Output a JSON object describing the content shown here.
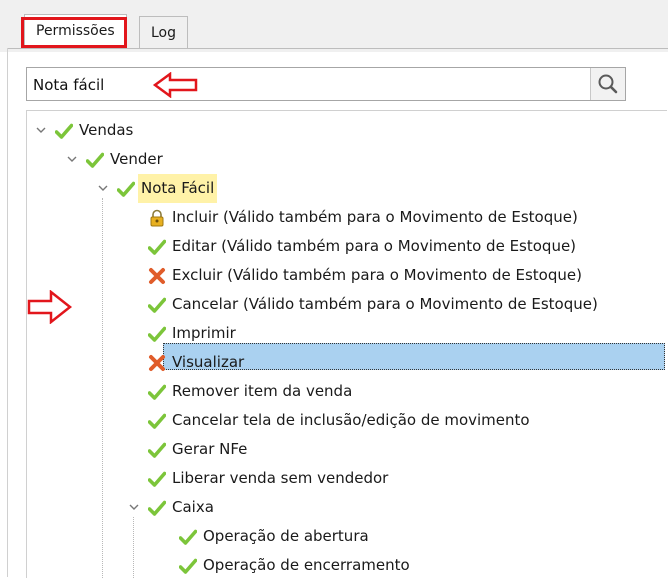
{
  "tabs": [
    {
      "label": "Permissões",
      "active": true
    },
    {
      "label": "Log",
      "active": false
    }
  ],
  "search": {
    "value": "Nota fácil",
    "button_icon": "search-icon"
  },
  "tree": [
    {
      "label": "Vendas",
      "icon": "check-icon",
      "expanded": true
    },
    {
      "label": "Vender",
      "icon": "check-icon",
      "expanded": true
    },
    {
      "label": "Nota Fácil",
      "icon": "check-icon",
      "expanded": true,
      "highlight": true
    },
    {
      "label": "Incluir (Válido também para o Movimento de Estoque)",
      "icon": "lock-icon"
    },
    {
      "label": "Editar (Válido também para o Movimento de Estoque)",
      "icon": "check-icon"
    },
    {
      "label": "Excluir (Válido também para o Movimento de Estoque)",
      "icon": "x-icon"
    },
    {
      "label": "Cancelar (Válido também para o Movimento de Estoque)",
      "icon": "check-icon"
    },
    {
      "label": "Imprimir",
      "icon": "check-icon"
    },
    {
      "label": "Visualizar",
      "icon": "x-icon",
      "selected": true
    },
    {
      "label": "Remover item da venda",
      "icon": "check-icon"
    },
    {
      "label": "Cancelar tela de inclusão/edição de movimento",
      "icon": "check-icon"
    },
    {
      "label": "Gerar NFe",
      "icon": "check-icon"
    },
    {
      "label": "Liberar venda sem vendedor",
      "icon": "check-icon"
    },
    {
      "label": "Caixa",
      "icon": "check-icon",
      "expanded": true
    },
    {
      "label": "Operação de abertura",
      "icon": "check-icon"
    },
    {
      "label": "Operação de encerramento",
      "icon": "check-icon"
    }
  ],
  "colors": {
    "check": "#7cc53a",
    "x": "#e05c2a",
    "lock": "#e8b020",
    "annotation": "#e2161c",
    "selection": "#aad1f0"
  }
}
